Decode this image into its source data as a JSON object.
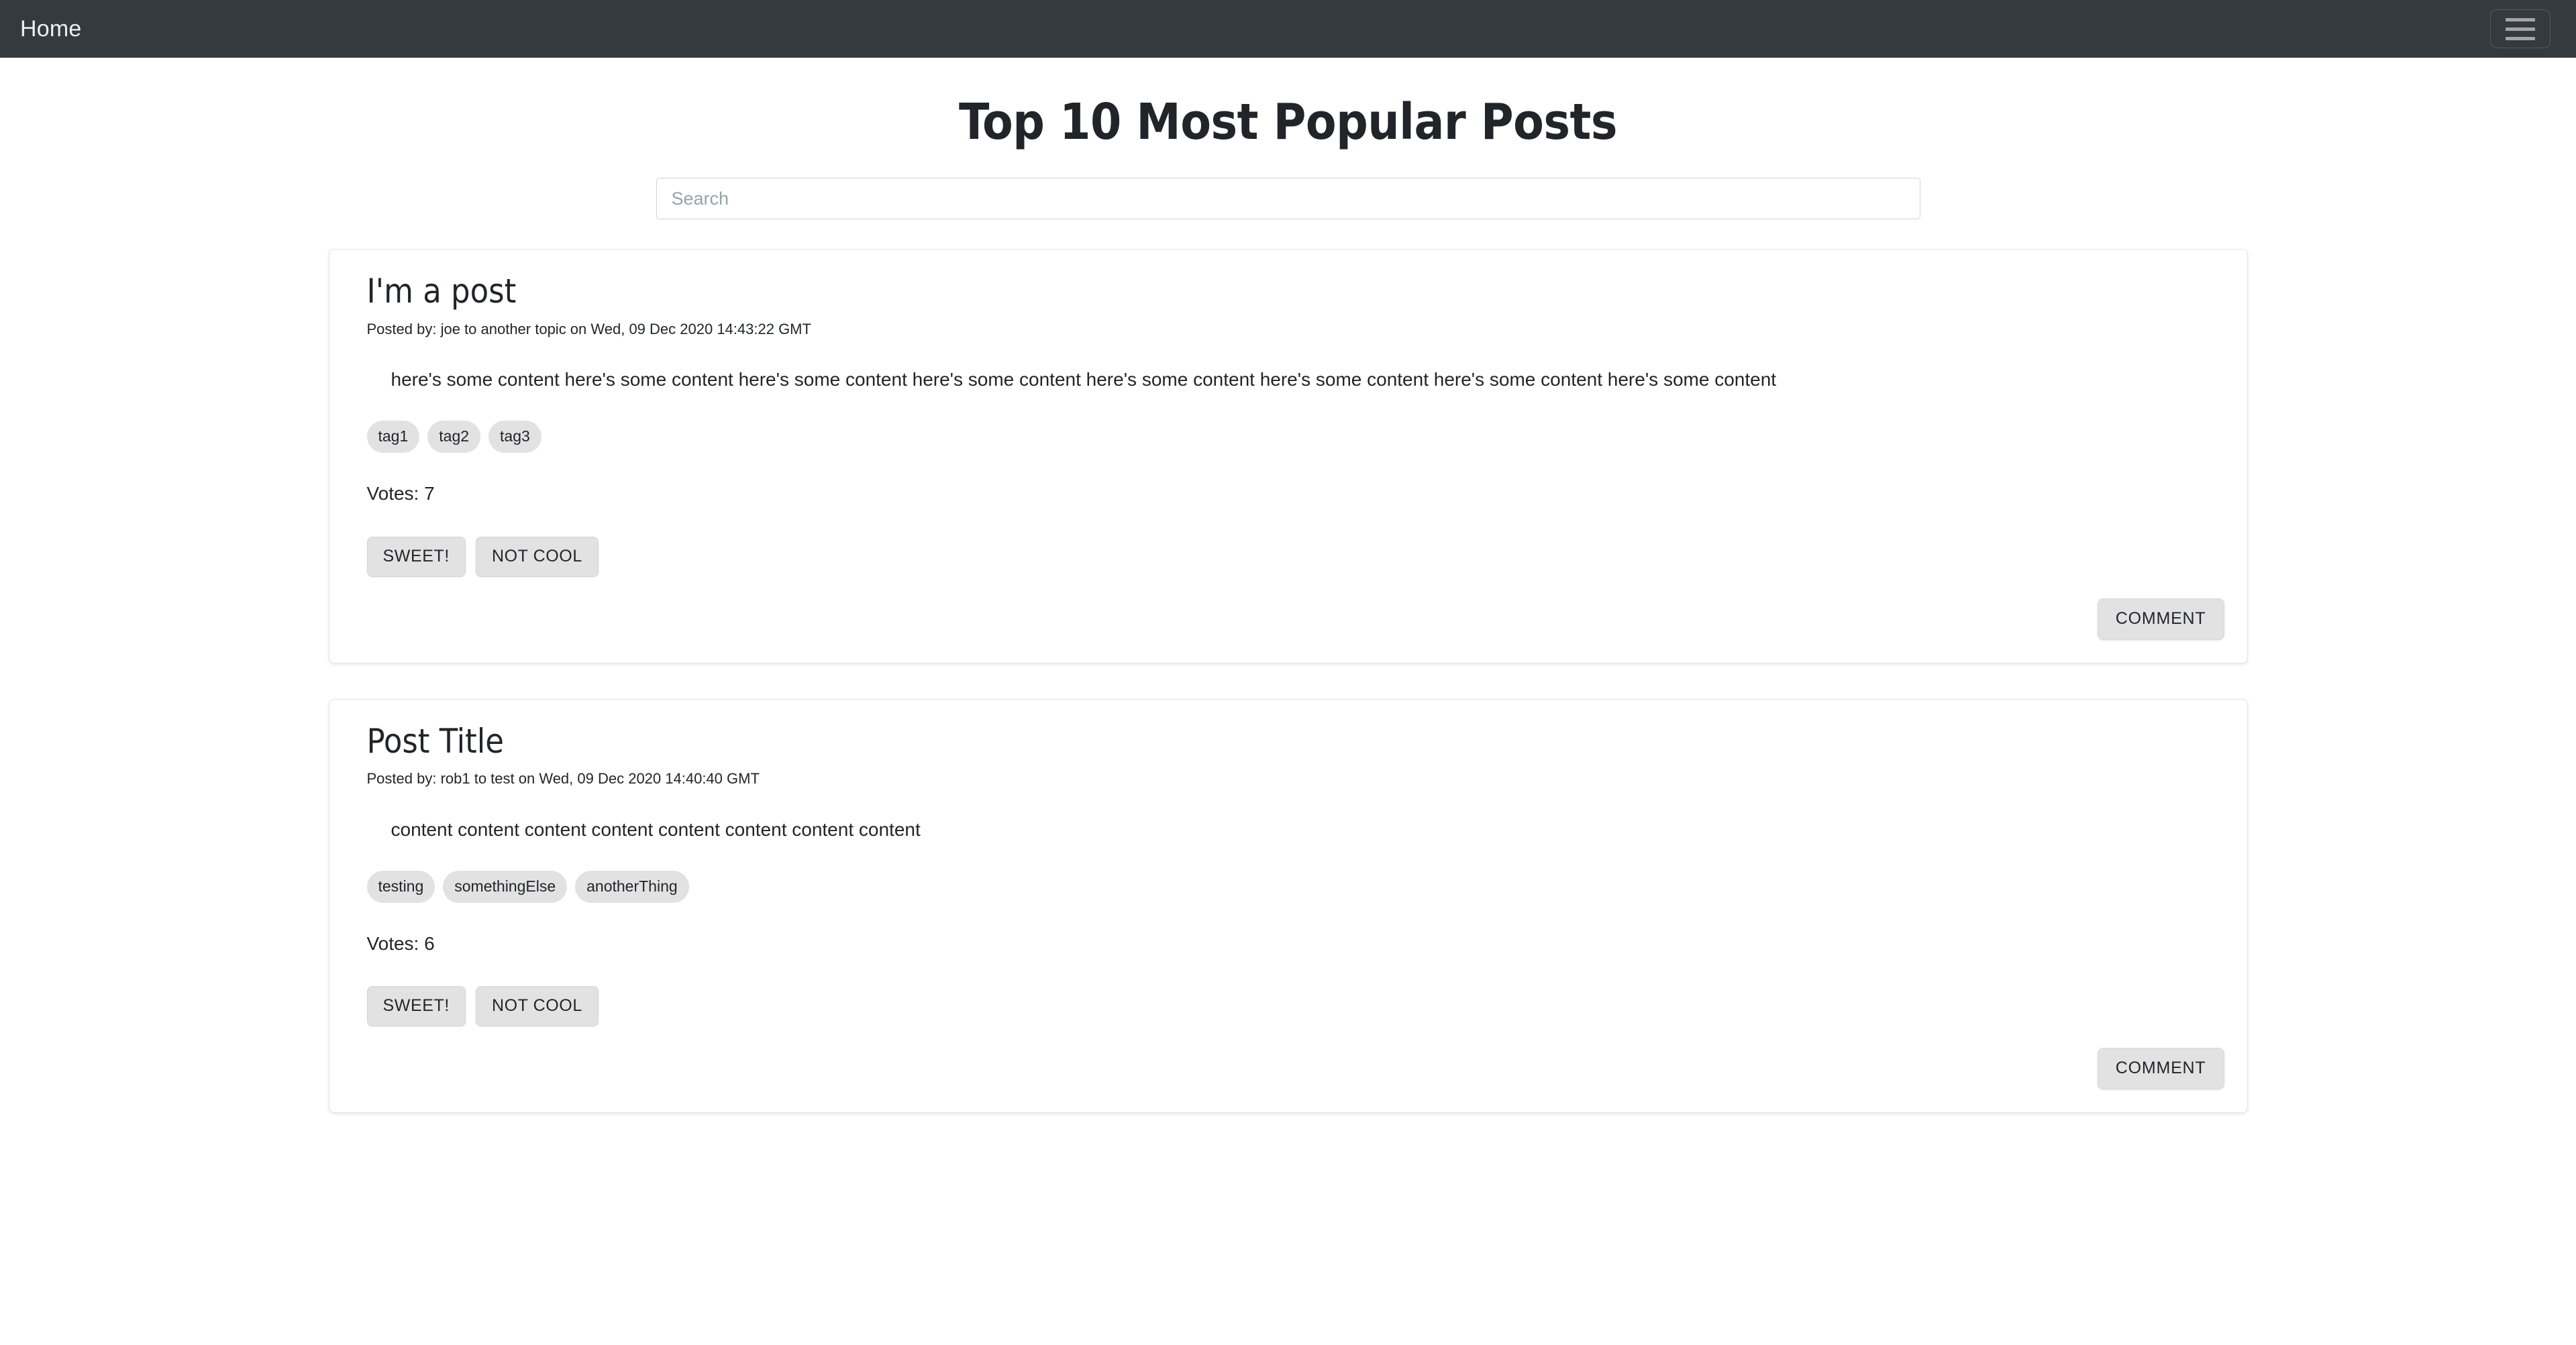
{
  "navbar": {
    "brand": "Home",
    "toggler_icon": "hamburger-menu-icon",
    "background_color": "#343a40"
  },
  "header": {
    "title": "Top 10 Most Popular Posts"
  },
  "search": {
    "value": "",
    "placeholder": "Search"
  },
  "posts": [
    {
      "title": "I'm a post",
      "meta": "Posted by: joe to another topic on Wed, 09 Dec 2020 14:43:22 GMT",
      "content": "here's some content here's some content here's some content here's some content here's some content here's some content here's some content here's some content",
      "tags": [
        "tag1",
        "tag2",
        "tag3"
      ],
      "votes_label": "Votes: 7",
      "upvote_label": "SWEET!",
      "downvote_label": "NOT COOL",
      "comment_label": "COMMENT"
    },
    {
      "title": "Post Title",
      "meta": "Posted by: rob1 to test on Wed, 09 Dec 2020 14:40:40 GMT",
      "content": "content content content content content content content content",
      "tags": [
        "testing",
        "somethingElse",
        "anotherThing"
      ],
      "votes_label": "Votes: 6",
      "upvote_label": "SWEET!",
      "downvote_label": "NOT COOL",
      "comment_label": "COMMENT"
    }
  ],
  "colors": {
    "navbar": "#343a40",
    "tag_background": "#e2e2e2",
    "button_background": "#e2e2e2",
    "text": "#212529"
  }
}
